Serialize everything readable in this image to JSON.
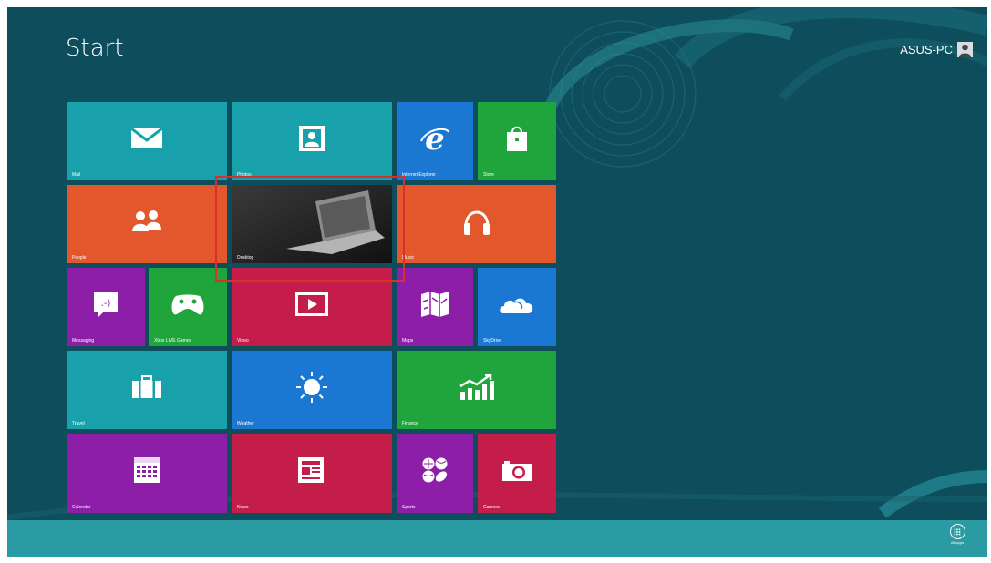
{
  "screen": {
    "title": "Start",
    "user_name": "ASUS-PC"
  },
  "colors": {
    "background": "#0d4d5c",
    "bottom_bar": "#2a9aa3",
    "teal_tile": "#18a0ab",
    "green_tile": "#20a43c",
    "orange_tile": "#e2572b",
    "purple_tile": "#8c1ea8",
    "crimson_tile": "#c41d49",
    "blue_tile": "#1b78d2",
    "highlight": "#d9302c"
  },
  "tiles": [
    {
      "label": "Mail",
      "icon": "mail-icon",
      "color": "#18a0ab"
    },
    {
      "label": "Photos",
      "icon": "photos-icon",
      "color": "#18a0ab"
    },
    {
      "label": "Internet Explorer",
      "icon": "internet-explorer-icon",
      "color": "#1b78d2"
    },
    {
      "label": "Store",
      "icon": "store-bag-icon",
      "color": "#20a43c"
    },
    {
      "label": "People",
      "icon": "people-icon",
      "color": "#e2572b"
    },
    {
      "label": "Desktop",
      "icon": "desktop-laptop-image",
      "color": "#202020"
    },
    {
      "label": "Music",
      "icon": "headphones-icon",
      "color": "#e2572b"
    },
    {
      "label": "Messaging",
      "icon": "messaging-icon",
      "color": "#8c1ea8"
    },
    {
      "label": "Xbox LIVE Games",
      "icon": "xbox-controller-icon",
      "color": "#20a43c"
    },
    {
      "label": "Video",
      "icon": "video-play-icon",
      "color": "#c41d49"
    },
    {
      "label": "Maps",
      "icon": "maps-icon",
      "color": "#8c1ea8"
    },
    {
      "label": "SkyDrive",
      "icon": "skydrive-cloud-icon",
      "color": "#1b78d2"
    },
    {
      "label": "Travel",
      "icon": "suitcase-icon",
      "color": "#18a0ab"
    },
    {
      "label": "Weather",
      "icon": "sun-icon",
      "color": "#1b78d2"
    },
    {
      "label": "Finance",
      "icon": "chart-up-icon",
      "color": "#20a43c"
    },
    {
      "label": "Calendar",
      "icon": "calendar-icon",
      "color": "#8c1ea8"
    },
    {
      "label": "News",
      "icon": "newspaper-icon",
      "color": "#c41d49"
    },
    {
      "label": "Sports",
      "icon": "sports-balls-icon",
      "color": "#8c1ea8"
    },
    {
      "label": "Camera",
      "icon": "camera-icon",
      "color": "#c41d49"
    }
  ],
  "bottom_bar": {
    "all_apps_label": "All apps",
    "all_apps_icon": "all-apps-icon"
  }
}
